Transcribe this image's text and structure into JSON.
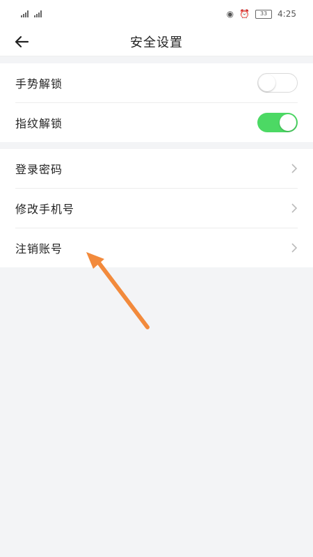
{
  "status_bar": {
    "time": "4:25",
    "battery": "33",
    "icons": [
      "sim-signal-icon",
      "sim-signal-icon",
      "eye-icon",
      "alarm-icon",
      "battery-icon"
    ]
  },
  "header": {
    "title": "安全设置",
    "back_icon": "back-arrow-icon"
  },
  "toggle_group": [
    {
      "label": "手势解锁",
      "enabled": false
    },
    {
      "label": "指纹解锁",
      "enabled": true
    }
  ],
  "menu_group": [
    {
      "label": "登录密码",
      "icon": "chevron-right-icon"
    },
    {
      "label": "修改手机号",
      "icon": "chevron-right-icon"
    },
    {
      "label": "注销账号",
      "icon": "chevron-right-icon"
    }
  ],
  "colors": {
    "toggle_on": "#4cd964",
    "annotation_arrow": "#f28a3c",
    "background": "#f3f4f6"
  }
}
